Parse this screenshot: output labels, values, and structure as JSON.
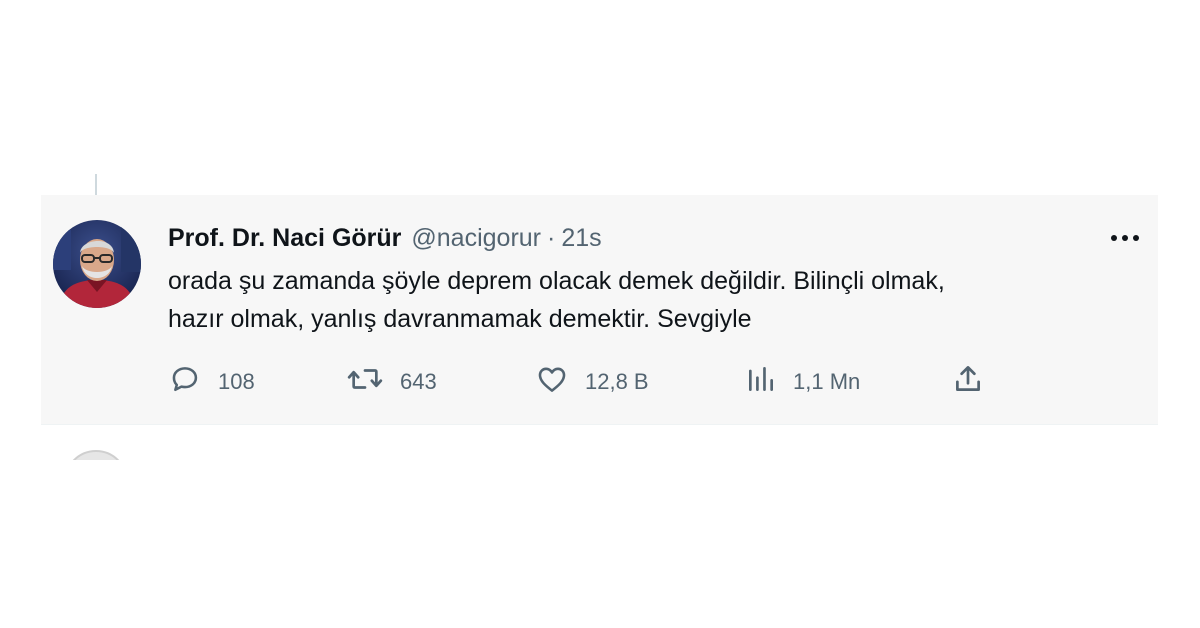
{
  "tweet": {
    "name": "Prof. Dr. Naci Görür",
    "handle": "@nacigorur",
    "separator": "·",
    "time": "21s",
    "text_line1": "orada şu zamanda şöyle deprem olacak demek değildir. Bilinçli olmak,",
    "text_line2": "hazır olmak, yanlış davranmamak demektir. Sevgiyle",
    "more_icon": "more-horizontal-icon"
  },
  "actions": {
    "reply": {
      "icon": "reply-icon",
      "count": "108"
    },
    "retweet": {
      "icon": "retweet-icon",
      "count": "643"
    },
    "like": {
      "icon": "heart-icon",
      "count": "12,8 B"
    },
    "views": {
      "icon": "views-chart-icon",
      "count": "1,1 Mn"
    },
    "share": {
      "icon": "share-icon"
    }
  },
  "colors": {
    "background": "#f7f7f7",
    "text_primary": "#0f1419",
    "text_secondary": "#536471",
    "thread_line": "#cfd9de"
  }
}
